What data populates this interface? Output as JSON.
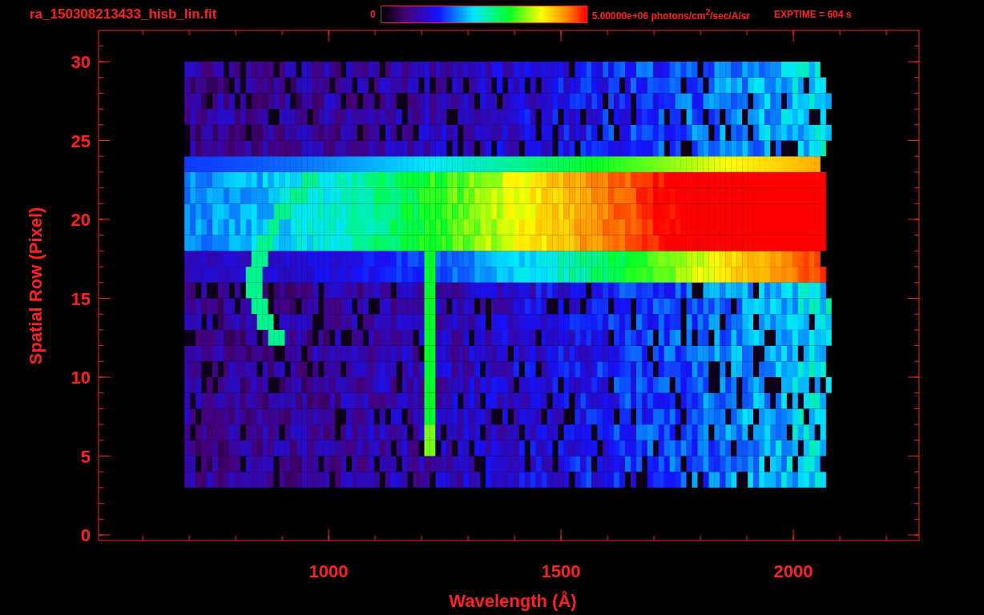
{
  "title": "ra_150308213433_hisb_lin.fit",
  "colorbar": {
    "min_label": "0",
    "max_label": "5.00000e+06 photons/cm$^{2}$/sec/A/sr"
  },
  "exposure": "EXPTIME = 604 s",
  "plot": {
    "xlabel": "Wavelength (Å)",
    "ylabel": "Spatial Row (Pixel)",
    "xticks": [
      "1000",
      "1500",
      "2000"
    ],
    "yticks": [
      "30",
      "25",
      "20",
      "15",
      "10",
      "5",
      "0"
    ]
  }
}
